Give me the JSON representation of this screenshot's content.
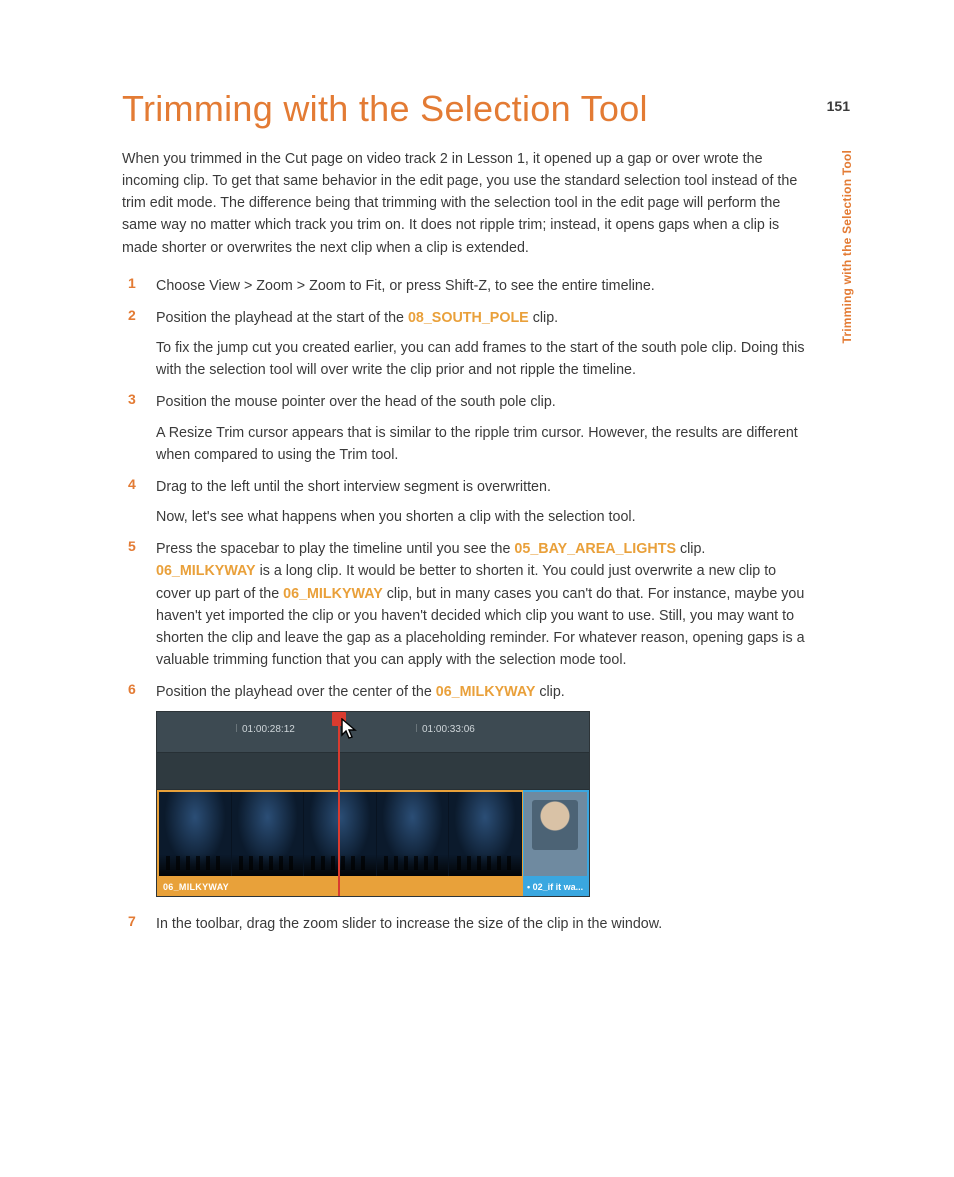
{
  "page_number": "151",
  "side_tab": "Trimming with the Selection Tool",
  "title": "Trimming with the Selection Tool",
  "intro": "When you trimmed in the Cut page on video track 2 in Lesson 1, it opened up a gap or over wrote the incoming clip. To get that same behavior in the edit page, you use the standard selection tool instead of the trim edit mode. The difference being that trimming with the selection tool in the edit page will perform the same way no matter which track you trim on. It does not ripple trim; instead, it opens gaps when a clip is made shorter or overwrites the next clip when a clip is extended.",
  "steps": {
    "s1": {
      "num": "1",
      "p1": "Choose View > Zoom > Zoom to Fit, or press Shift-Z, to see the entire timeline."
    },
    "s2": {
      "num": "2",
      "p1a": "Position the playhead at the start of the ",
      "clip1": "08_SOUTH_POLE",
      "p1b": " clip.",
      "p2": "To fix the jump cut you created earlier, you can add frames to the start of the south pole clip. Doing this with the selection tool will over write the clip prior and not ripple the timeline."
    },
    "s3": {
      "num": "3",
      "p1": "Position the mouse pointer over the head of the south pole clip.",
      "p2": "A Resize Trim cursor appears that is similar to the ripple trim cursor. However, the results are different when compared to using the Trim tool."
    },
    "s4": {
      "num": "4",
      "p1": "Drag to the left until the short interview segment is overwritten.",
      "p2": "Now, let's see what happens when you shorten a clip with the selection tool."
    },
    "s5": {
      "num": "5",
      "p1a": "Press the spacebar to play the timeline until you see the ",
      "clip1": "05_BAY_AREA_LIGHTS",
      "p1b": " clip. ",
      "clip2": "06_MILKYWAY",
      "p1c": " is a long clip. It would be better to shorten it. You could just overwrite a new clip to cover up part of the ",
      "clip3": "06_MILKYWAY",
      "p1d": " clip, but in many cases you can't do that. For instance, maybe you haven't yet imported the clip or you haven't decided which clip you want to use. Still, you may want to shorten the clip and leave the gap as a placeholding reminder. For whatever reason, opening gaps is a valuable trimming function that you can apply with the selection mode tool."
    },
    "s6": {
      "num": "6",
      "p1a": "Position the playhead over the center of the ",
      "clip1": "06_MILKYWAY",
      "p1b": " clip."
    },
    "s7": {
      "num": "7",
      "p1": "In the toolbar, drag the zoom slider to increase the size of the clip in the window."
    }
  },
  "timeline": {
    "tick1": "01:00:28:12",
    "tick2": "01:00:33:06",
    "clip_main_label": "06_MILKYWAY",
    "clip_side_label": "• 02_if it wa..."
  }
}
